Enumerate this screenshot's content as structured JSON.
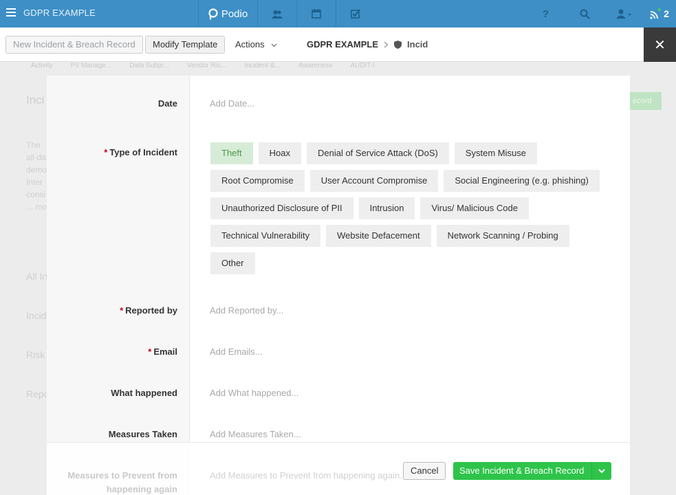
{
  "topbar": {
    "workspace": "GDPR EXAMPLE",
    "brand": "Podio",
    "notification_count": "2",
    "icons": [
      "menu-icon",
      "podio-logo-icon",
      "contacts-icon",
      "calendar-icon",
      "tasks-icon",
      "help-icon",
      "search-icon",
      "user-icon",
      "notifications-icon"
    ],
    "colors": {
      "bar": "#3d8fc6",
      "save": "#2ec44a",
      "selected_chip": "#d7ecd7"
    }
  },
  "toolbar": {
    "new_record_label": "New Incident & Breach Record",
    "modify_template_label": "Modify Template",
    "actions_label": "Actions",
    "breadcrumb_workspace": "GDPR EXAMPLE",
    "breadcrumb_app": "Incid"
  },
  "background": {
    "tabs": [
      "Activity",
      "PII Manage...",
      "Data Subje...",
      "Vendor Ris...",
      "Incident &...",
      "Awareness",
      "AUDIT-I"
    ],
    "texts": [
      "Inci",
      "The",
      "all da",
      "demo",
      "Inter",
      "consi",
      "... mo",
      "All In",
      "Incid",
      "Risk",
      "Repo"
    ],
    "button": "ecord"
  },
  "form": {
    "date": {
      "label": "Date",
      "placeholder": "Add Date..."
    },
    "type_of_incident": {
      "label": "Type of Incident",
      "required": "*",
      "selected": "Theft",
      "options": [
        [
          "Theft",
          "Hoax",
          "Denial of Service Attack (DoS)",
          "System Misuse"
        ],
        [
          "Root Compromise",
          "User Account Compromise",
          "Social Engineering (e.g. phishing)"
        ],
        [
          "Unauthorized Disclosure of PII",
          "Intrusion",
          "Virus/ Malicious Code"
        ],
        [
          "Technical Vulnerability",
          "Website Defacement",
          "Network Scanning / Probing"
        ],
        [
          "Other"
        ]
      ]
    },
    "reported_by": {
      "label": "Reported by",
      "required": "*",
      "placeholder": "Add Reported by..."
    },
    "email": {
      "label": "Email",
      "required": "*",
      "placeholder": "Add Emails..."
    },
    "what_happened": {
      "label": "What happened",
      "placeholder": "Add What happened..."
    },
    "measures_taken": {
      "label": "Measures Taken",
      "placeholder": "Add Measures Taken..."
    },
    "measures_prevent": {
      "label_line1": "Measures to Prevent from",
      "label_line2": "happening again",
      "placeholder": "Add Measures to Prevent from happening again..."
    }
  },
  "footer": {
    "cancel_label": "Cancel",
    "save_label": "Save Incident & Breach Record"
  }
}
